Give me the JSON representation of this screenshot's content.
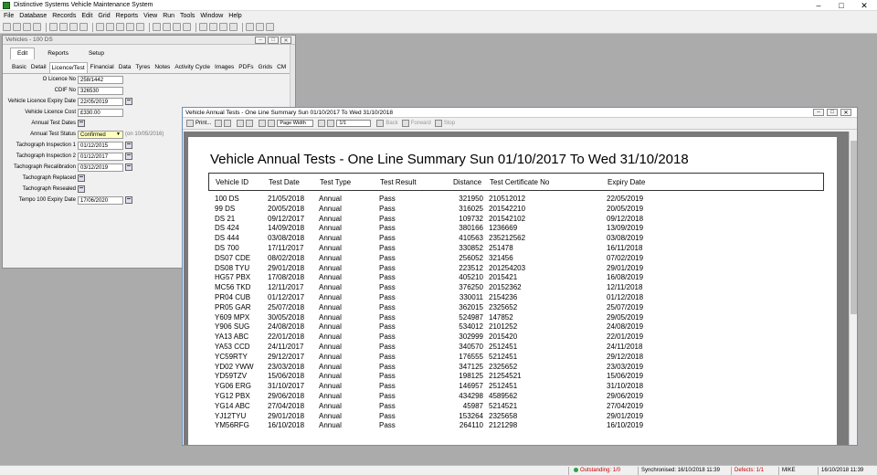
{
  "app": {
    "title": "Distinctive Systems Vehicle Maintenance System"
  },
  "menu": [
    "File",
    "Database",
    "Records",
    "Edit",
    "Grid",
    "Reports",
    "View",
    "Run",
    "Tools",
    "Window",
    "Help"
  ],
  "vehicles_window": {
    "title": "Vehicles - 100 DS",
    "top_tabs": [
      "Edit",
      "Reports",
      "Setup"
    ],
    "sub_tabs": [
      "Basic",
      "Detail",
      "Licence/Test",
      "Financial",
      "Data",
      "Tyres",
      "Notes",
      "Activity Cycle",
      "Images",
      "PDFs",
      "Grids",
      "CM"
    ],
    "fields": {
      "o_licence_no_label": "O Licence No",
      "o_licence_no": "258/1442",
      "cdif_no_label": "CDIF No",
      "cdif_no": "326530",
      "licence_expiry_label": "Vehicle Licence Expiry Date",
      "licence_expiry": "22/05/2019",
      "licence_cost_label": "Vehicle Licence Cost",
      "licence_cost": "£330.00",
      "annual_test_dates_label": "Annual Test Dates",
      "annual_test_status_label": "Annual Test Status",
      "annual_test_status": "Confirmed",
      "annual_test_status_note": "(on 10/05/2016)",
      "tach_insp1_label": "Tachograph Inspection 1",
      "tach_insp1": "01/12/2015",
      "tach_insp2_label": "Tachograph Inspection 2",
      "tach_insp2": "01/12/2017",
      "tach_recal_label": "Tachograph Recalibration",
      "tach_recal": "03/12/2019",
      "tach_replaced_label": "Tachograph Replaced",
      "tach_resealed_label": "Tachograph Resealed",
      "tempo_label": "Tempo 100 Expiry Date",
      "tempo": "17/06/2020"
    }
  },
  "report_window": {
    "title": "Vehicle Annual Tests - One Line Summary Sun 01/10/2017 To Wed 31/10/2018",
    "toolbar": {
      "print": "Print...",
      "zoom": "Page Width",
      "page": "1/1",
      "back": "Back",
      "forward": "Forward",
      "stop": "Stop"
    },
    "report_title": "Vehicle Annual Tests - One Line Summary Sun 01/10/2017 To Wed 31/10/2018",
    "columns": [
      "Vehicle ID",
      "Test Date",
      "Test Type",
      "Test Result",
      "Distance",
      "Test Certificate No",
      "Expiry Date"
    ],
    "rows": [
      [
        "100 DS",
        "21/05/2018",
        "Annual",
        "Pass",
        "321950",
        "210512012",
        "22/05/2019"
      ],
      [
        "99 DS",
        "20/05/2018",
        "Annual",
        "Pass",
        "316025",
        "201542210",
        "20/05/2019"
      ],
      [
        "DS 21",
        "09/12/2017",
        "Annual",
        "Pass",
        "109732",
        "201542102",
        "09/12/2018"
      ],
      [
        "DS 424",
        "14/09/2018",
        "Annual",
        "Pass",
        "380166",
        "1236669",
        "13/09/2019"
      ],
      [
        "DS 444",
        "03/08/2018",
        "Annual",
        "Pass",
        "410563",
        "235212562",
        "03/08/2019"
      ],
      [
        "DS 700",
        "17/11/2017",
        "Annual",
        "Pass",
        "330852",
        "251478",
        "16/11/2018"
      ],
      [
        "DS07 CDE",
        "08/02/2018",
        "Annual",
        "Pass",
        "256052",
        "321456",
        "07/02/2019"
      ],
      [
        "DS08 TYU",
        "29/01/2018",
        "Annual",
        "Pass",
        "223512",
        "201254203",
        "29/01/2019"
      ],
      [
        "HG57 PBX",
        "17/08/2018",
        "Annual",
        "Pass",
        "405210",
        "2015421",
        "16/08/2019"
      ],
      [
        "MC56 TKD",
        "12/11/2017",
        "Annual",
        "Pass",
        "376250",
        "20152362",
        "12/11/2018"
      ],
      [
        "PR04 CUB",
        "01/12/2017",
        "Annual",
        "Pass",
        "330011",
        "2154236",
        "01/12/2018"
      ],
      [
        "PR05 GAR",
        "25/07/2018",
        "Annual",
        "Pass",
        "362015",
        "2325652",
        "25/07/2019"
      ],
      [
        "Y609 MPX",
        "30/05/2018",
        "Annual",
        "Pass",
        "524987",
        "147852",
        "29/05/2019"
      ],
      [
        "Y906 SUG",
        "24/08/2018",
        "Annual",
        "Pass",
        "534012",
        "2101252",
        "24/08/2019"
      ],
      [
        "YA13 ABC",
        "22/01/2018",
        "Annual",
        "Pass",
        "302999",
        "2015420",
        "22/01/2019"
      ],
      [
        "YA53 CCD",
        "24/11/2017",
        "Annual",
        "Pass",
        "340570",
        "2512451",
        "24/11/2018"
      ],
      [
        "YC59RTY",
        "29/12/2017",
        "Annual",
        "Pass",
        "176555",
        "5212451",
        "29/12/2018"
      ],
      [
        "YD02 YWW",
        "23/03/2018",
        "Annual",
        "Pass",
        "347125",
        "2325652",
        "23/03/2019"
      ],
      [
        "YD59TZV",
        "15/06/2018",
        "Annual",
        "Pass",
        "198125",
        "21254521",
        "15/06/2019"
      ],
      [
        "YG06 ERG",
        "31/10/2017",
        "Annual",
        "Pass",
        "146957",
        "2512451",
        "31/10/2018"
      ],
      [
        "YG12 PBX",
        "29/06/2018",
        "Annual",
        "Pass",
        "434298",
        "4589562",
        "29/06/2019"
      ],
      [
        "YG14 ABC",
        "27/04/2018",
        "Annual",
        "Pass",
        "45987",
        "5214521",
        "27/04/2019"
      ],
      [
        "YJ12TYU",
        "29/01/2018",
        "Annual",
        "Pass",
        "153264",
        "2325658",
        "29/01/2019"
      ],
      [
        "YM56RFG",
        "16/10/2018",
        "Annual",
        "Pass",
        "264110",
        "2121298",
        "16/10/2019"
      ]
    ]
  },
  "status": {
    "outstanding": "Outstanding: 1/0",
    "synchronised": "Synchronised: 16/10/2018 11:39",
    "defects": "Defects: 1/1",
    "user": "MIKE",
    "datetime": "16/10/2018 11:39"
  },
  "colors": {
    "status_green": "#2ea043",
    "defects_red": "#c00000",
    "combo_yellow": "#ffffc0"
  }
}
